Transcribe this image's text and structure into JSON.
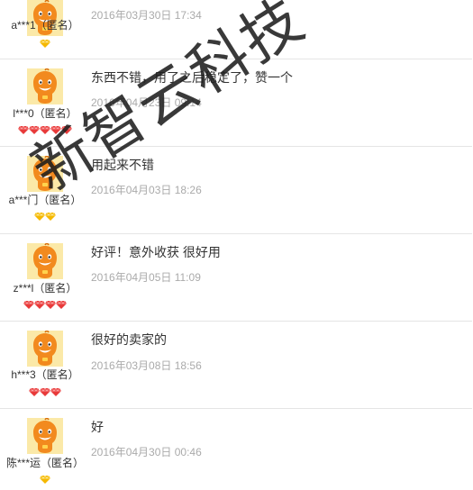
{
  "reviews": [
    {
      "user": "a***1（匿名）",
      "text": "",
      "date": "2016年03月30日 17:34",
      "rank": "1 yellow diamond"
    },
    {
      "user": "l***0（匿名）",
      "text": "东西不错，用了之后稳定了，赞一个",
      "date": "2016年04月23日 09:14",
      "rank": "5 red diamonds"
    },
    {
      "user": "a***门（匿名）",
      "text": "用起来不错",
      "date": "2016年04月03日 18:26",
      "rank": "2 yellow diamonds"
    },
    {
      "user": "z***l（匿名）",
      "text": "好评！意外收获 很好用",
      "date": "2016年04月05日 11:09",
      "rank": "4 red diamonds"
    },
    {
      "user": "h***3（匿名）",
      "text": "很好的卖家的",
      "date": "2016年03月08日 18:56",
      "rank": "3 red diamonds"
    },
    {
      "user": "陈***运（匿名）",
      "text": "好",
      "date": "2016年04月30日 00:46",
      "rank": "1 yellow diamond"
    }
  ],
  "watermark": "新智云科技",
  "colors": {
    "avatar": "#f28a1e",
    "yellow_diamond": "#f5b800",
    "red_diamond": "#e83a3a",
    "date": "#aaaaaa",
    "divider": "#e5e5e5"
  },
  "icons": {
    "avatar": "orange-cartoon-avatar-icon",
    "yellow_rank": "yellow-diamond-icon",
    "red_rank": "red-diamond-icon"
  }
}
